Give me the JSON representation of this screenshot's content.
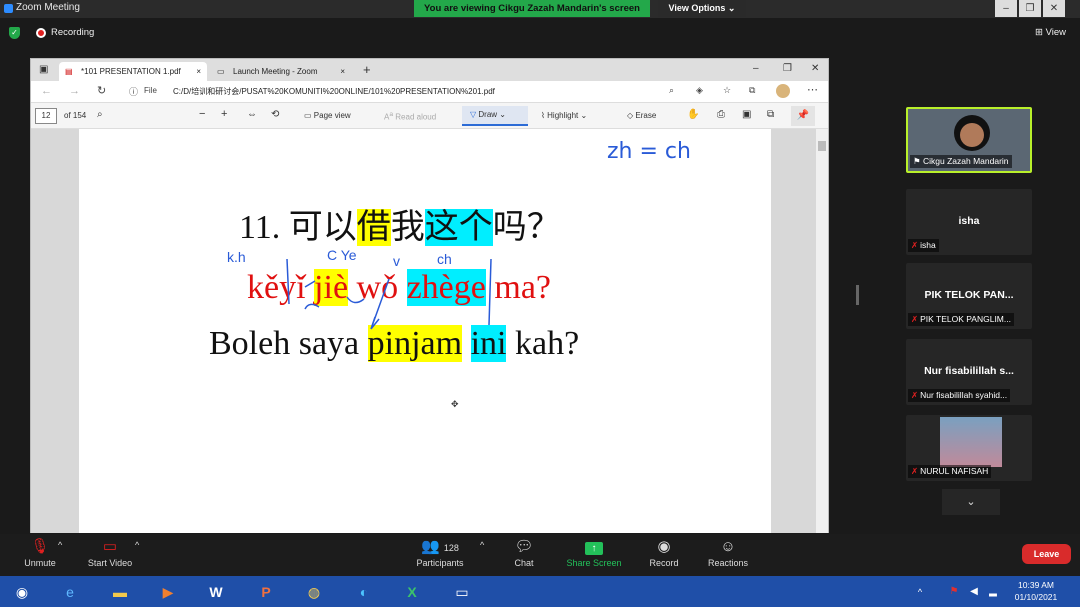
{
  "zoom": {
    "window_title": "Zoom Meeting",
    "viewing_banner": "You are viewing Cikgu Zazah Mandarin's screen",
    "view_options": "View Options",
    "recording": "Recording",
    "view_label": "View"
  },
  "browser": {
    "tabs": [
      {
        "label": "*101 PRESENTATION 1.pdf",
        "close": "×"
      },
      {
        "label": "Launch Meeting - Zoom",
        "close": "×"
      }
    ],
    "file_label": "File",
    "url": "C:/D/培训和研讨会/PUSAT%20KOMUNITI%20ONLINE/101%20PRESENTATION%201.pdf"
  },
  "pdf_toolbar": {
    "page_number": "12",
    "page_total": "of 154",
    "page_view": "Page view",
    "read_aloud": "Read aloud",
    "draw": "Draw",
    "highlight": "Highlight",
    "erase": "Erase"
  },
  "slide": {
    "number": "11.",
    "hanzi": [
      "可以",
      "借",
      "我",
      "这个",
      "吗？"
    ],
    "pinyin": [
      "kěyǐ ",
      "jiè",
      " wǒ ",
      "zhège",
      " ma?"
    ],
    "malay": [
      "Boleh saya ",
      "pinjam",
      " ",
      "ini",
      " kah?"
    ],
    "annotations": {
      "top_right": "zh = ch",
      "k_h": "k.h",
      "c_ye": "C Ye",
      "v": "v",
      "ch": "ch"
    }
  },
  "participants": [
    {
      "name": "Cikgu Zazah Mandarin",
      "video": true,
      "muted": false
    },
    {
      "name": "isha",
      "label": "isha",
      "muted": true
    },
    {
      "name": "PIK TELOK PAN...",
      "label": "PIK TELOK PANGLIM...",
      "muted": true
    },
    {
      "name": "Nur fisabilillah s...",
      "label": "Nur fisabilillah syahid...",
      "muted": true
    },
    {
      "name": "NURUL NAFISAH",
      "label": "NURUL NAFISAH",
      "muted": true,
      "video": true
    }
  ],
  "toolbar": {
    "unmute": "Unmute",
    "start_video": "Start Video",
    "participants_count": "128",
    "participants": "Participants",
    "chat": "Chat",
    "share_screen": "Share Screen",
    "record": "Record",
    "reactions": "Reactions",
    "leave": "Leave"
  },
  "taskbar": {
    "time": "10:39 AM",
    "date": "01/10/2021"
  },
  "colors": {
    "highlight_yellow": "#ffff00",
    "highlight_cyan": "#00eeff",
    "pinyin_red": "#e01010",
    "zoom_green": "#23a84a",
    "leave_red": "#d92b2b"
  }
}
